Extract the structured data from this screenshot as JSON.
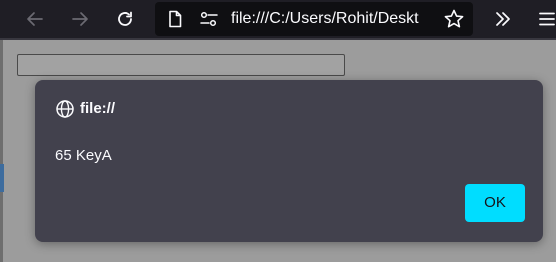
{
  "toolbar": {
    "back_icon": "arrow-left-icon",
    "forward_icon": "arrow-right-icon",
    "reload_icon": "reload-icon",
    "url": "file:///C:/Users/Rohit/Deskt",
    "page_icon": "page-icon",
    "permissions_icon": "permissions-icon",
    "bookmark_icon": "star-icon",
    "overflow_icon": "chevrons-right-icon",
    "menu_icon": "hamburger-menu-icon"
  },
  "page": {
    "text_input_value": ""
  },
  "dialog": {
    "origin_icon": "globe-icon",
    "origin": "file://",
    "message": "65 KeyA",
    "ok_label": "OK"
  },
  "colors": {
    "toolbar_bg": "#1f1e25",
    "urlbar_bg": "#0f0f12",
    "dialog_bg": "#42414d",
    "accent": "#00ddff",
    "page_overlay": "#9c9c9c"
  }
}
